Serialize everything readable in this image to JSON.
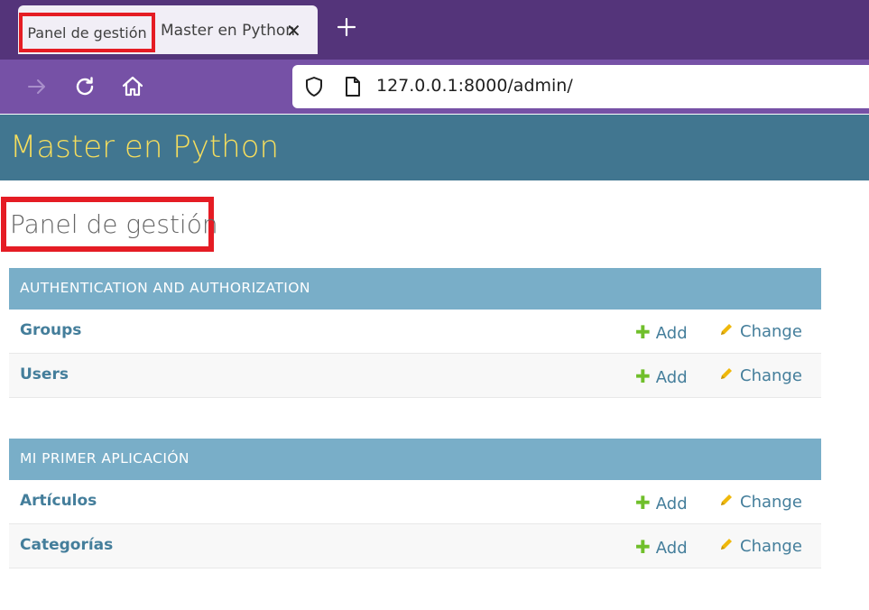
{
  "browser": {
    "active_tab_title": "Panel de gestión",
    "tab_title": "Master en Python",
    "url": "127.0.0.1:8000/admin/"
  },
  "admin": {
    "branding": "Master en Python",
    "page_title": "Panel de gestión",
    "modules": [
      {
        "caption": "AUTHENTICATION AND AUTHORIZATION",
        "models": [
          {
            "name": "Groups",
            "add_label": "Add",
            "change_label": "Change"
          },
          {
            "name": "Users",
            "add_label": "Add",
            "change_label": "Change"
          }
        ]
      },
      {
        "caption": "MI PRIMER APLICACIÓN",
        "models": [
          {
            "name": "Artículos",
            "add_label": "Add",
            "change_label": "Change"
          },
          {
            "name": "Categorías",
            "add_label": "Add",
            "change_label": "Change"
          }
        ]
      }
    ]
  },
  "colors": {
    "tabbar": "#54347a",
    "navbar": "#7651a6",
    "header": "#417690",
    "branding": "#f5dd5d",
    "module_caption": "#79aec8",
    "link": "#447e9b",
    "add_icon": "#70bf2b",
    "change_icon": "#efb80b",
    "highlight": "#e51c24"
  },
  "icons": [
    "close-icon",
    "plus-icon",
    "forward-arrow-icon",
    "reload-icon",
    "home-icon",
    "shield-icon",
    "page-icon",
    "add-icon",
    "pencil-icon"
  ]
}
